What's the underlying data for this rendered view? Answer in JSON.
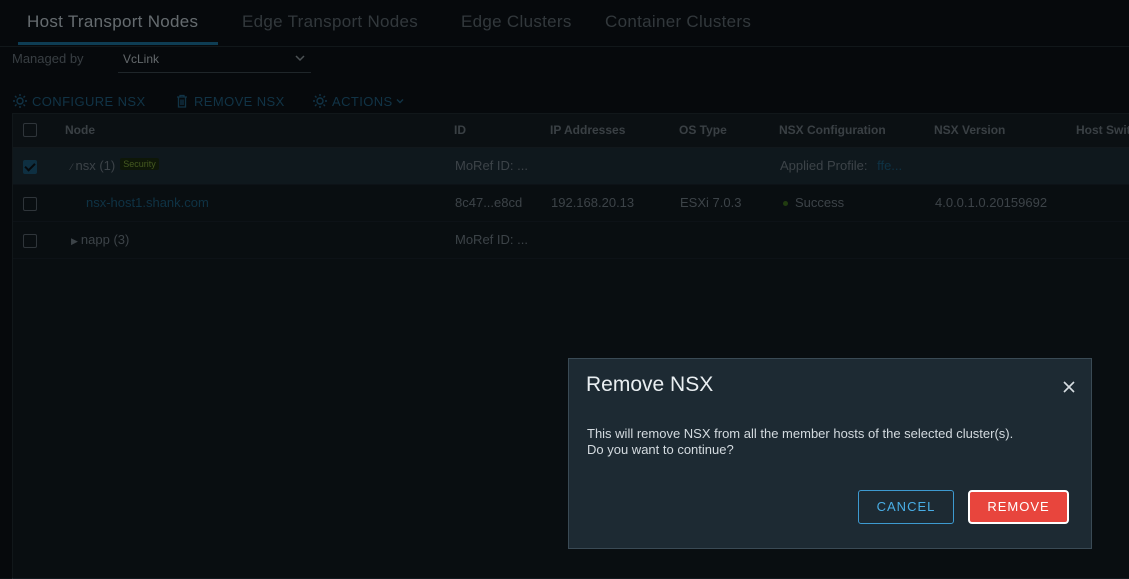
{
  "tabs": [
    {
      "label": "Host Transport Nodes"
    },
    {
      "label": "Edge Transport Nodes"
    },
    {
      "label": "Edge Clusters"
    },
    {
      "label": "Container Clusters"
    }
  ],
  "managed_by": {
    "label": "Managed by",
    "value": "VcLink"
  },
  "toolbar": {
    "configure": "CONFIGURE NSX",
    "remove": "REMOVE NSX",
    "actions": "ACTIONS"
  },
  "grid": {
    "columns": [
      "Node",
      "ID",
      "IP Addresses",
      "OS Type",
      "NSX Configuration",
      "NSX Version",
      "Host Swit"
    ],
    "rows": [
      {
        "node": "nsx (1)",
        "badge": "Security",
        "id": "MoRef ID: ...",
        "ip": "",
        "os": "",
        "config_label": "Applied Profile:",
        "config_value": "ffe...",
        "version": "",
        "selected": true
      },
      {
        "node": "nsx-host1.shank.com",
        "id": "8c47...e8cd",
        "ip": "192.168.20.13",
        "os": "ESXi 7.0.3",
        "config": "Success",
        "version": "4.0.0.1.0.20159692",
        "selected": false
      },
      {
        "node": "napp (3)",
        "id": "MoRef ID: ...",
        "ip": "",
        "os": "",
        "config": "",
        "version": "",
        "selected": false
      }
    ]
  },
  "modal": {
    "title": "Remove NSX",
    "line1": "This will remove NSX from all the member hosts of the selected cluster(s).",
    "line2": "Do you want to continue?",
    "cancel": "CANCEL",
    "remove": "REMOVE"
  },
  "colors": {
    "accent": "#1a6f99",
    "danger": "#e8453d",
    "success": "#3d6e1e"
  }
}
